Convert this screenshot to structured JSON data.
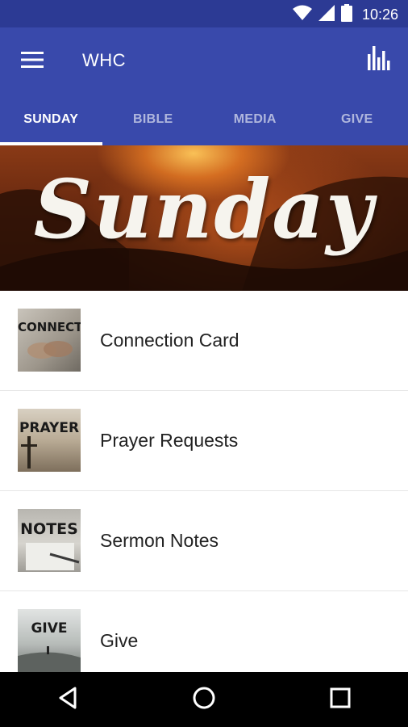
{
  "status_bar": {
    "time": "10:26",
    "icons": [
      "wifi-icon",
      "signal-icon",
      "battery-icon"
    ]
  },
  "app_bar": {
    "title": "WHC",
    "menu_icon": "hamburger-menu-icon",
    "action_icon": "bar-chart-icon"
  },
  "tabs": [
    {
      "label": "SUNDAY",
      "active": true
    },
    {
      "label": "BIBLE",
      "active": false
    },
    {
      "label": "MEDIA",
      "active": false
    },
    {
      "label": "GIVE",
      "active": false
    }
  ],
  "banner": {
    "title": "Sunday"
  },
  "items": [
    {
      "thumb_text": "CONNECT",
      "label": "Connection Card"
    },
    {
      "thumb_text": "PRAYER",
      "label": "Prayer Requests"
    },
    {
      "thumb_text": "NOTES",
      "label": "Sermon Notes"
    },
    {
      "thumb_text": "GIVE",
      "label": "Give"
    }
  ],
  "nav_bar": {
    "buttons": [
      "back-icon",
      "home-icon",
      "recents-icon"
    ]
  },
  "colors": {
    "primary": "#3949ab",
    "status_bar": "#2c3a94",
    "nav_bar": "#000000"
  }
}
